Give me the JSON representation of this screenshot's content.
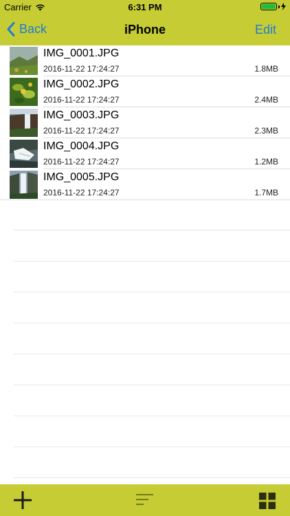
{
  "status_bar": {
    "carrier": "Carrier",
    "time": "6:31 PM"
  },
  "nav": {
    "back_label": "Back",
    "title": "iPhone",
    "edit_label": "Edit"
  },
  "files": [
    {
      "name": "IMG_0001.JPG",
      "date": "2016-11-22 17:24:27",
      "size": "1.8MB"
    },
    {
      "name": "IMG_0002.JPG",
      "date": "2016-11-22 17:24:27",
      "size": "2.4MB"
    },
    {
      "name": "IMG_0003.JPG",
      "date": "2016-11-22 17:24:27",
      "size": "2.3MB"
    },
    {
      "name": "IMG_0004.JPG",
      "date": "2016-11-22 17:24:27",
      "size": "1.2MB"
    },
    {
      "name": "IMG_0005.JPG",
      "date": "2016-11-22 17:24:27",
      "size": "1.7MB"
    }
  ],
  "toolbar": {
    "icons": [
      "add-icon",
      "sort-icon",
      "grid-view-icon"
    ]
  },
  "colors": {
    "bar": "#c6cc33",
    "accent": "#1f7bd6",
    "battery": "#1dbf3a"
  }
}
